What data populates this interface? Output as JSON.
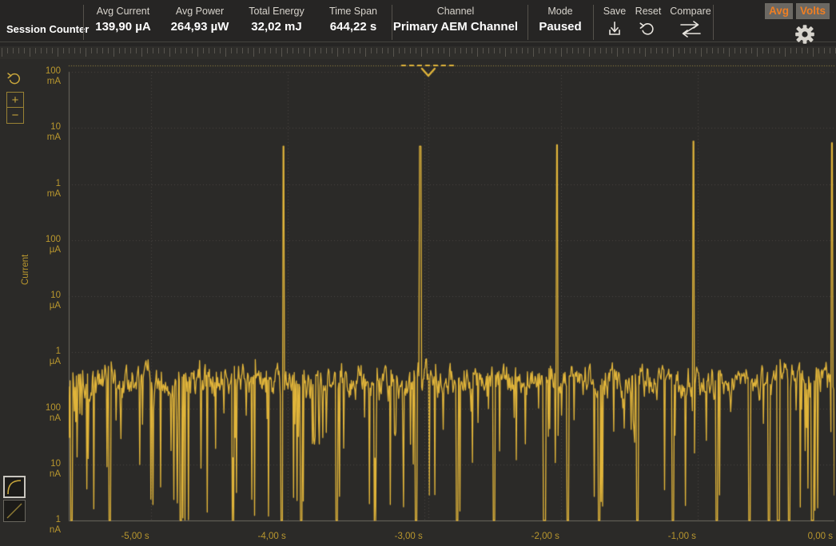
{
  "header": {
    "session_counter_label": "Session Counter",
    "stats": [
      {
        "label": "Avg Current",
        "value": "139,90 µA"
      },
      {
        "label": "Avg Power",
        "value": "264,93 µW"
      },
      {
        "label": "Total Energy",
        "value": "32,02 mJ"
      },
      {
        "label": "Time Span",
        "value": "644,22 s"
      }
    ],
    "channel": {
      "label": "Channel",
      "value": "Primary AEM Channel"
    },
    "mode": {
      "label": "Mode",
      "value": "Paused"
    },
    "actions": [
      {
        "label": "Save",
        "icon": "download-icon"
      },
      {
        "label": "Reset",
        "icon": "undo-icon"
      },
      {
        "label": "Compare",
        "icon": "compare-arrows-icon"
      }
    ],
    "toggles": [
      {
        "label": "Avg",
        "active": true
      },
      {
        "label": "Volts",
        "active": true
      }
    ],
    "settings_icon": "gear-icon"
  },
  "controls": {
    "zoom_reset_icon": "rotate-reset-icon",
    "zoom_in_label": "+",
    "zoom_out_label": "−",
    "scale_log_icon": "log-curve-icon",
    "scale_linear_icon": "linear-line-icon",
    "scale_selected": "log"
  },
  "colors": {
    "background": "#2b2a28",
    "header_background": "#262524",
    "trace": "#e0b43a",
    "axis_text": "#b9972e",
    "grid": "#4a4843",
    "accent_orange": "#ef7f23",
    "text_primary": "#ffffff"
  },
  "chart_data": {
    "type": "line",
    "title": "",
    "xlabel": "",
    "ylabel": "Current",
    "x_unit": "s",
    "y_scale": "log",
    "xlim": [
      -5.6,
      0.0
    ],
    "ylim": [
      1e-09,
      0.1
    ],
    "grid": true,
    "legend": null,
    "x_ticks": [
      -5,
      -4,
      -3,
      -2,
      -1,
      0
    ],
    "x_tick_labels": [
      "-5,00 s",
      "-4,00 s",
      "-3,00 s",
      "-2,00 s",
      "-1,00 s",
      "0,00 s"
    ],
    "y_ticks": [
      0.1,
      0.01,
      0.001,
      0.0001,
      1e-05,
      1e-06,
      1e-07,
      1e-08,
      1e-09
    ],
    "y_tick_labels": [
      [
        "100",
        "mA"
      ],
      [
        "10",
        "mA"
      ],
      [
        "1",
        "mA"
      ],
      [
        "100",
        "µA"
      ],
      [
        "10",
        "µA"
      ],
      [
        "1",
        "µA"
      ],
      [
        "100",
        "nA"
      ],
      [
        "10",
        "nA"
      ],
      [
        "1",
        "nA"
      ]
    ],
    "series": [
      {
        "name": "Primary AEM Channel",
        "color": "#e0b43a",
        "noise_floor_a": 2.2e-07,
        "noise_band_a": [
          1.2e-07,
          7e-07
        ],
        "baseline_drop_a": 1e-09,
        "peaks": [
          {
            "t": -4.03,
            "current_a": 0.0047
          },
          {
            "t": -3.03,
            "current_a": 0.0047
          },
          {
            "t": -2.03,
            "current_a": 0.005
          },
          {
            "t": -1.03,
            "current_a": 0.0058
          },
          {
            "t": -0.02,
            "current_a": 0.0054
          }
        ],
        "dropout_times": [
          -5.58,
          -5.3,
          -4.78,
          -4.4,
          -4.04,
          -3.9,
          -3.64,
          -3.36,
          -3.06,
          -2.76,
          -2.49,
          -2.12,
          -1.95,
          -1.72,
          -1.44,
          -1.18,
          -0.86,
          -0.62,
          -0.48,
          -0.41,
          -0.33,
          -0.16
        ]
      }
    ],
    "marker": {
      "t": -2.97,
      "label": "",
      "icon": "chevron-down-marker"
    }
  }
}
